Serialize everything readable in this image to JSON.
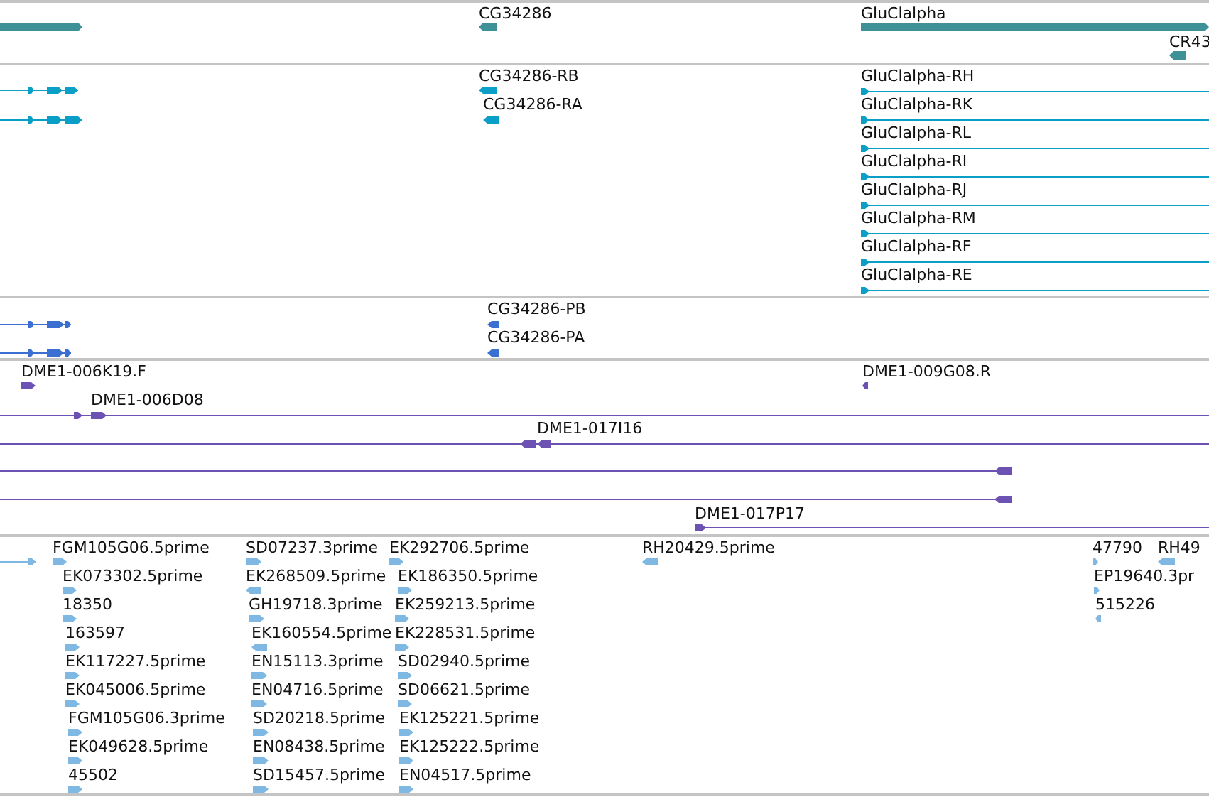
{
  "tracks": [
    {
      "kind": "genes",
      "color": "#3f9198",
      "features": [
        {
          "reverse": false
        },
        {
          "label": "CG34286",
          "reverse": true
        },
        {
          "label": "GluClalpha",
          "reverse": false
        },
        {
          "label": "CR43",
          "reverse": true
        }
      ]
    },
    {
      "kind": "transcripts",
      "color": "#0a9fc6",
      "features": [
        {
          "reverse": false
        },
        {
          "reverse": false
        },
        {
          "label": "CG34286-RB",
          "reverse": true
        },
        {
          "label": "CG34286-RA",
          "reverse": true
        },
        {
          "label": "GluClalpha-RH",
          "reverse": false
        },
        {
          "label": "GluClalpha-RK",
          "reverse": false
        },
        {
          "label": "GluClalpha-RL",
          "reverse": false
        },
        {
          "label": "GluClalpha-RI",
          "reverse": false
        },
        {
          "label": "GluClalpha-RJ",
          "reverse": false
        },
        {
          "label": "GluClalpha-RM",
          "reverse": false
        },
        {
          "label": "GluClalpha-RF",
          "reverse": false
        },
        {
          "label": "GluClalpha-RE",
          "reverse": false
        }
      ]
    },
    {
      "kind": "proteins",
      "color": "#3b6fd1",
      "features": [
        {
          "reverse": false
        },
        {
          "reverse": false
        },
        {
          "label": "CG34286-PB",
          "reverse": true
        },
        {
          "label": "CG34286-PA",
          "reverse": true
        }
      ]
    },
    {
      "kind": "clones",
      "color": "#6b52b3",
      "features": [
        {
          "label": "DME1-006K19.F",
          "reverse": false
        },
        {
          "label": "DME1-009G08.R",
          "reverse": true
        },
        {
          "label": "DME1-006D08",
          "reverse": false
        },
        {
          "label": "DME1-017I16",
          "reverse": true
        },
        {
          "reverse": true
        },
        {
          "reverse": true
        },
        {
          "label": "DME1-017P17",
          "reverse": false
        }
      ]
    },
    {
      "kind": "ests",
      "color": "#7fb8e2",
      "features": [
        {
          "reverse": false
        },
        {
          "label": "FGM105G06.5prime",
          "reverse": false
        },
        {
          "label": "EK073302.5prime",
          "reverse": false
        },
        {
          "label": "18350",
          "reverse": false
        },
        {
          "label": "163597",
          "reverse": false
        },
        {
          "label": "EK117227.5prime",
          "reverse": false
        },
        {
          "label": "EK045006.5prime",
          "reverse": false
        },
        {
          "label": "FGM105G06.3prime",
          "reverse": false
        },
        {
          "label": "EK049628.5prime",
          "reverse": false
        },
        {
          "label": "45502",
          "reverse": false
        },
        {
          "label": "SD07237.3prime",
          "reverse": false
        },
        {
          "label": "EK268509.5prime",
          "reverse": true
        },
        {
          "label": "GH19718.3prime",
          "reverse": false
        },
        {
          "label": "EK160554.5prime",
          "reverse": true
        },
        {
          "label": "EN15113.3prime",
          "reverse": false
        },
        {
          "label": "EN04716.5prime",
          "reverse": false
        },
        {
          "label": "SD20218.5prime",
          "reverse": false
        },
        {
          "label": "EN08438.5prime",
          "reverse": false
        },
        {
          "label": "SD15457.5prime",
          "reverse": false
        },
        {
          "label": "EK292706.5prime",
          "reverse": false
        },
        {
          "label": "EK186350.5prime",
          "reverse": false
        },
        {
          "label": "EK259213.5prime",
          "reverse": false
        },
        {
          "label": "EK228531.5prime",
          "reverse": false
        },
        {
          "label": "SD02940.5prime",
          "reverse": false
        },
        {
          "label": "SD06621.5prime",
          "reverse": false
        },
        {
          "label": "EK125221.5prime",
          "reverse": false
        },
        {
          "label": "EK125222.5prime",
          "reverse": false
        },
        {
          "label": "EN04517.5prime",
          "reverse": false
        },
        {
          "label": "RH20429.5prime",
          "reverse": true
        },
        {
          "label": "47790",
          "reverse": false
        },
        {
          "label": "RH49",
          "reverse": true
        },
        {
          "label": "EP19640.3pr",
          "reverse": false
        },
        {
          "label": "515226",
          "reverse": true
        }
      ]
    }
  ]
}
